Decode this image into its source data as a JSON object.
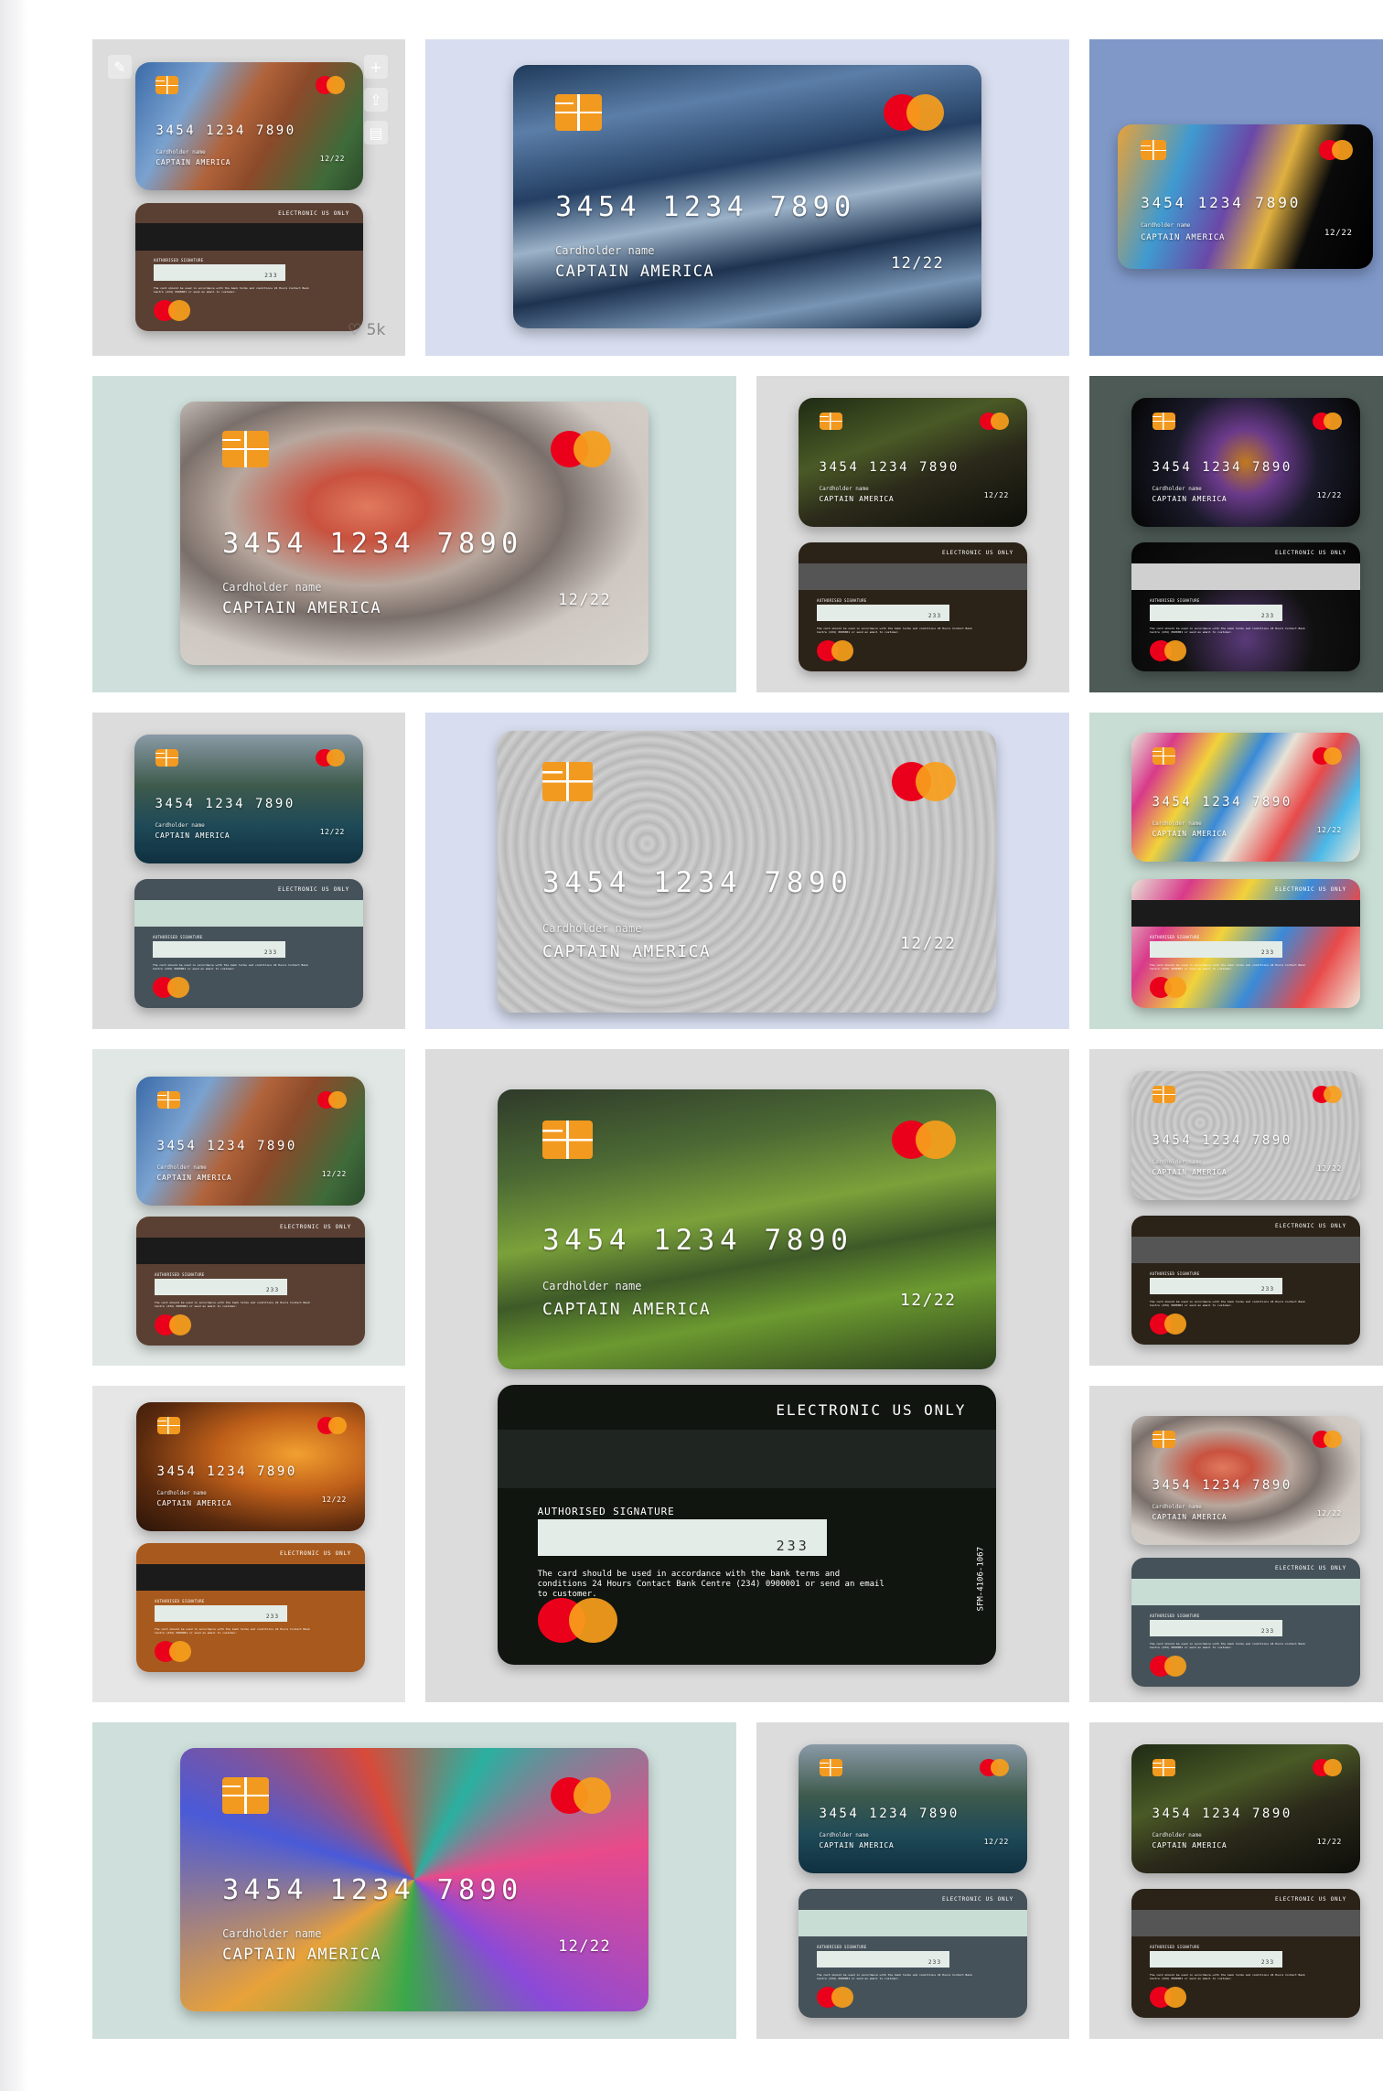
{
  "card": {
    "number": "3454  1234  7890",
    "holder_label": "Cardholder name",
    "holder_name": "CAPTAIN AMERICA",
    "expiry": "12/22"
  },
  "card_back": {
    "header": "ELECTRONIC US ONLY",
    "signature_label": "AUTHORISED SIGNATURE",
    "cvv": "233",
    "terms": "The card should be used in accordance with the bank terms and conditions 24 Hours Contact Bank Centre (234) 0900001 or send an email to customer.",
    "serial": "SFM-4106-1067"
  },
  "first_tile": {
    "likes": "5k",
    "tools": [
      "pencil-icon",
      "plus-icon",
      "share-icon",
      "comment-icon"
    ]
  },
  "colors": {
    "mastercard_red": "#eb001b",
    "mastercard_orange": "#f79e1b",
    "chip": "#f29a20"
  }
}
